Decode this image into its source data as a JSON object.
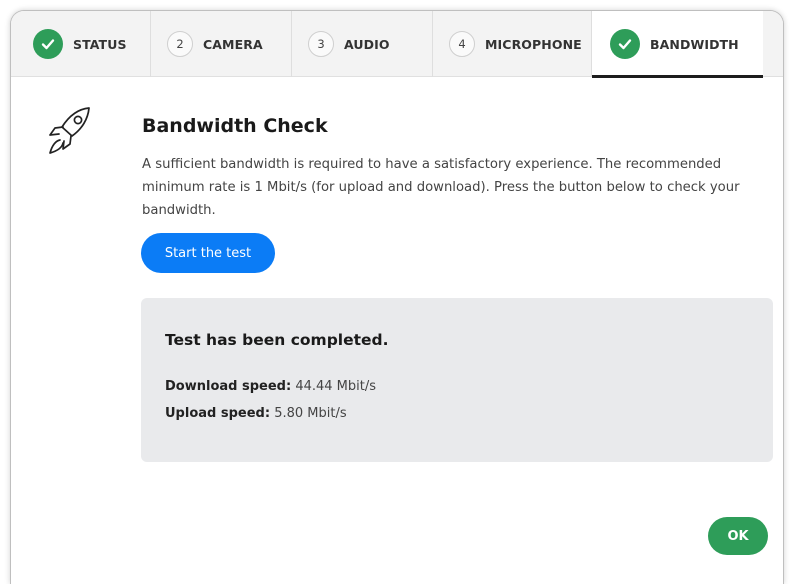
{
  "tabs": [
    {
      "label": "STATUS",
      "state": "completed"
    },
    {
      "label": "CAMERA",
      "number": "2",
      "state": "pending"
    },
    {
      "label": "AUDIO",
      "number": "3",
      "state": "pending"
    },
    {
      "label": "MICROPHONE",
      "number": "4",
      "state": "pending"
    },
    {
      "label": "BANDWIDTH",
      "state": "completed-active"
    }
  ],
  "content": {
    "icon": "rocket-icon",
    "title": "Bandwidth Check",
    "description": "A sufficient bandwidth is required to have a satisfactory experience. The recommended minimum rate is 1 Mbit/s (for upload and download). Press the button below to check your bandwidth.",
    "start_button": "Start the test"
  },
  "result": {
    "title": "Test has been completed.",
    "download_label": "Download speed:",
    "download_value": "44.44 Mbit/s",
    "upload_label": "Upload speed:",
    "upload_value": "5.80 Mbit/s"
  },
  "footer": {
    "ok_label": "OK"
  },
  "colors": {
    "success": "#2e9d59",
    "primary": "#0b7cf6",
    "panel": "#e9eaec"
  }
}
